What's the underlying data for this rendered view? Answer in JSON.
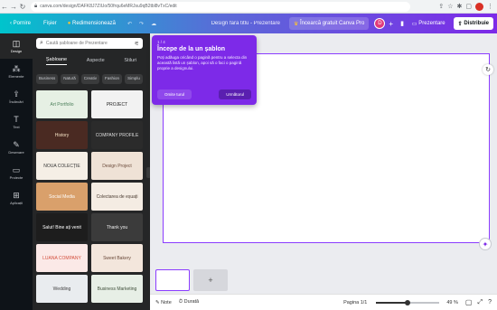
{
  "browser": {
    "url": "canva.com/design/DAFK8J7ZIUo/50frqu6eMRJsu9qB2tbl8vTxC/edit"
  },
  "topbar": {
    "home": "Pornire",
    "file": "Fișier",
    "resize": "Redimensionează",
    "doc_title": "Design fără titlu - Prezentare",
    "try_pro": "Încearcă gratuit Canva Pro",
    "avatar_letter": "D",
    "present": "Prezentare",
    "share": "Distribuie"
  },
  "rail": [
    {
      "icon": "layout-icon",
      "glyph": "◫",
      "label": "Design"
    },
    {
      "icon": "elements-icon",
      "glyph": "⁂",
      "label": "Elemente"
    },
    {
      "icon": "upload-icon",
      "glyph": "⇪",
      "label": "Încărcări"
    },
    {
      "icon": "text-icon",
      "glyph": "T",
      "label": "Text"
    },
    {
      "icon": "draw-icon",
      "glyph": "✎",
      "label": "Desenare"
    },
    {
      "icon": "folder-icon",
      "glyph": "▭",
      "label": "Proiecte"
    },
    {
      "icon": "apps-icon",
      "glyph": "⊞",
      "label": "Aplicații"
    }
  ],
  "panel": {
    "search_placeholder": "Caută șabloane de Prezentare",
    "tabs": [
      "Șabloane",
      "Aspecte",
      "Stiluri"
    ],
    "chips": [
      "Business",
      "Natură",
      "Creativ",
      "Fashion",
      "Simplu"
    ],
    "templates": [
      {
        "title": "Art Portfolio",
        "bg": "#e6f0e4",
        "fg": "#4b7f5a"
      },
      {
        "title": "PROJECT",
        "bg": "#f2f2f2",
        "fg": "#222"
      },
      {
        "title": "History",
        "bg": "#4a2a22",
        "fg": "#f3e0c2"
      },
      {
        "title": "COMPANY PROFILE",
        "bg": "#2b2b2b",
        "fg": "#ddd"
      },
      {
        "title": "NOUA COLECȚIE",
        "bg": "#f5efe6",
        "fg": "#333"
      },
      {
        "title": "Design Project",
        "bg": "#efe2d6",
        "fg": "#6b4a3a"
      },
      {
        "title": "Social Media",
        "bg": "#d9a06b",
        "fg": "#fff"
      },
      {
        "title": "Colectarea de eșuați",
        "bg": "#f4ece3",
        "fg": "#4a3b30"
      },
      {
        "title": "Salut! Bine ați venit",
        "bg": "#1d1d1d",
        "fg": "#fff"
      },
      {
        "title": "Thank you",
        "bg": "#3b3b3b",
        "fg": "#eee"
      },
      {
        "title": "LUANA COMPANY",
        "bg": "#fbe9e7",
        "fg": "#d4513f"
      },
      {
        "title": "Sweet Bakery",
        "bg": "#f3e6dc",
        "fg": "#6b4a3a"
      },
      {
        "title": "Wedding",
        "bg": "#e9ecef",
        "fg": "#444"
      },
      {
        "title": "Business Marketing",
        "bg": "#e7efe6",
        "fg": "#3f4f3a"
      }
    ]
  },
  "tooltip": {
    "step": "1 / 4",
    "title": "Începe de la un șablon",
    "body": "Poți adăuga oricând o pagină pentru a selecta din această listă un șablon, apoi să o faci o pagină proprie a designului.",
    "skip": "Omite turul",
    "next": "Următorul"
  },
  "footer": {
    "notes": "Note",
    "duration": "Durată",
    "page": "Pagina 1/1",
    "zoom": "49 %",
    "zoom_level": 0.49
  }
}
